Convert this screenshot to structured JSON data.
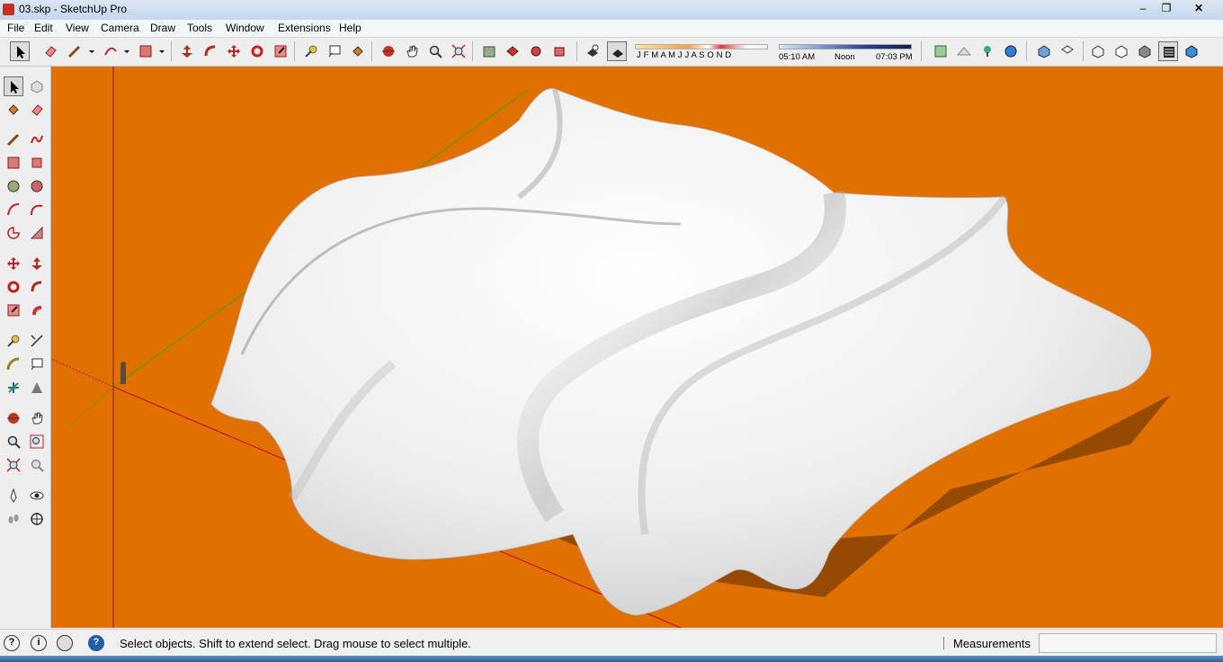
{
  "window": {
    "title": "03.skp - SketchUp Pro"
  },
  "menu": [
    "File",
    "Edit",
    "View",
    "Camera",
    "Draw",
    "Tools",
    "Window",
    "Extensions",
    "Help"
  ],
  "shadow_settings": {
    "months": "J F M A M J J A S O N D",
    "time_start": "05:10 AM",
    "time_noon": "Noon",
    "time_end": "07:03 PM"
  },
  "status": {
    "message": "Select objects. Shift to extend select. Drag mouse to select multiple.",
    "measurements_label": "Measurements",
    "measurements_value": ""
  },
  "colors": {
    "viewport_background": "#e07000",
    "model_surface": "#f2f2f2",
    "axis_red": "#c40000",
    "axis_green": "#5a9a00"
  }
}
